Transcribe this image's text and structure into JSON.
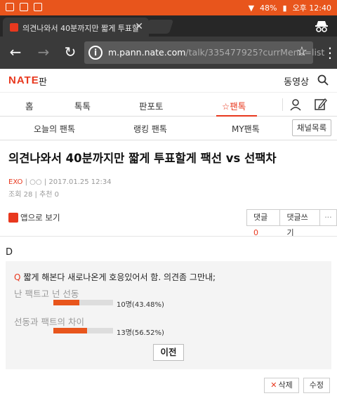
{
  "status_bar": {
    "battery": "48%",
    "time": "오후 12:40"
  },
  "browser": {
    "tab_title": "의견나와서 40분까지만 짧게 투표할",
    "url_host": "m.pann.nate.com",
    "url_path": "/talk/335477925?currMenu=list"
  },
  "header": {
    "logo": "NATE",
    "logo_suffix": "판",
    "video": "동영상"
  },
  "main_nav": {
    "home": "홈",
    "talk": "톡톡",
    "panpo": "판포토",
    "pantok": "☆팬톡"
  },
  "sub_nav": {
    "today": "오늘의 팬톡",
    "ranking": "랭킹 팬톡",
    "my": "MY팬톡",
    "channel_list": "채널목록"
  },
  "article": {
    "title": "의견나와서 40분까지만 짧게 투표할게 팩선 vs 선팩차",
    "author": "EXO",
    "author_extra": "○○",
    "date": "2017.01.25 12:34",
    "views": "조회 28",
    "recommend": "추천 0",
    "app_view": "앱으로 보기",
    "comment_label": "댓글",
    "comment_count": "0",
    "write_comment": "댓글쓰기",
    "more": "···",
    "body": "D"
  },
  "poll": {
    "question_mark": "Q",
    "question": "짧게 해본다 새로나온게 호응있어서 함. 의견좀 그만내;",
    "options": [
      {
        "label": "난 팩트고 넌 선동",
        "result": "10명(43.48%)",
        "percent": 43.48
      },
      {
        "label": "선동과 팩트의 차이",
        "result": "13명(56.52%)",
        "percent": 56.52
      }
    ],
    "prev_button": "이전"
  },
  "actions": {
    "delete": "삭제",
    "edit": "수정"
  },
  "colors": {
    "accent": "#e8381e",
    "status_bar": "#e8551c",
    "toolbar": "#3a3a3a"
  }
}
